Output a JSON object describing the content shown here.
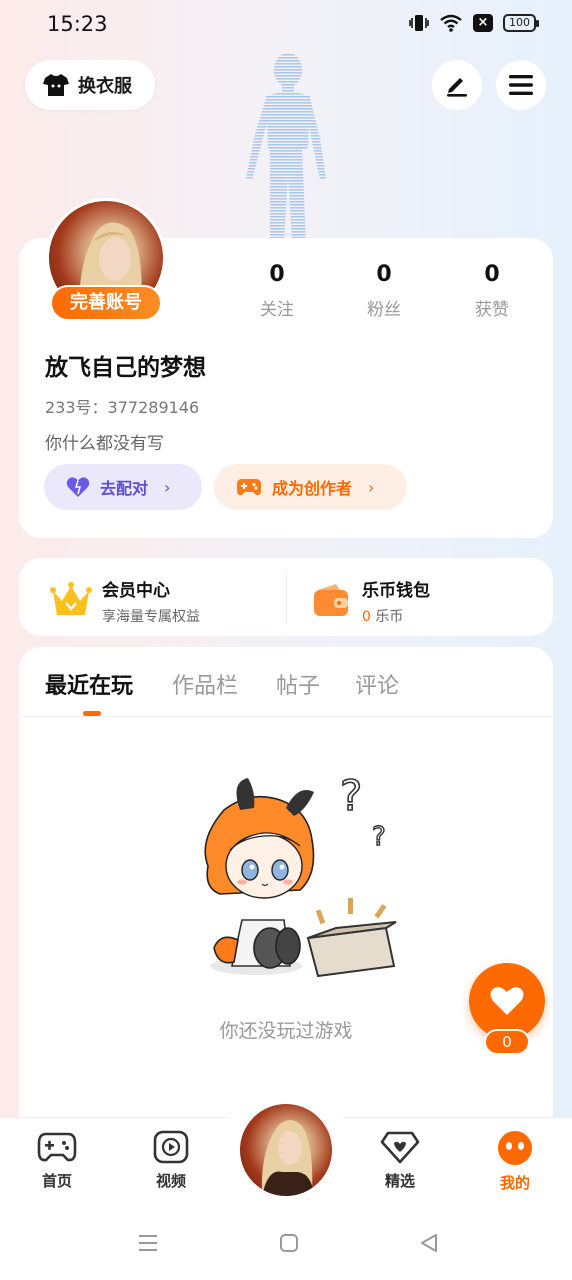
{
  "status_bar": {
    "time": "15:23",
    "battery": "100"
  },
  "header": {
    "outfit_label": "换衣服"
  },
  "profile": {
    "badge": "完善账号",
    "stats": [
      {
        "value": "0",
        "label": "关注"
      },
      {
        "value": "0",
        "label": "粉丝"
      },
      {
        "value": "0",
        "label": "获赞"
      }
    ],
    "username": "放飞自己的梦想",
    "uid": "233号：377289146",
    "bio": "你什么都没有写",
    "match_button": "去配对",
    "creator_button": "成为创作者"
  },
  "member": {
    "vip_title": "会员中心",
    "vip_sub": "享海量专属权益",
    "wallet_title": "乐币钱包",
    "wallet_amount": "0",
    "wallet_unit": "乐币"
  },
  "tabs": [
    "最近在玩",
    "作品栏",
    "帖子",
    "评论"
  ],
  "empty_state": {
    "text": "你还没玩过游戏"
  },
  "fab": {
    "count": "0"
  },
  "bottom_nav": [
    {
      "label": "首页",
      "icon": "gamepad-icon"
    },
    {
      "label": "视频",
      "icon": "video-play-icon"
    },
    {
      "label": "精选",
      "icon": "heart-diamond-icon"
    },
    {
      "label": "我的",
      "icon": "profile-face-icon"
    }
  ],
  "colors": {
    "accent": "#ff6a00",
    "purple": "#5c4fd6"
  }
}
